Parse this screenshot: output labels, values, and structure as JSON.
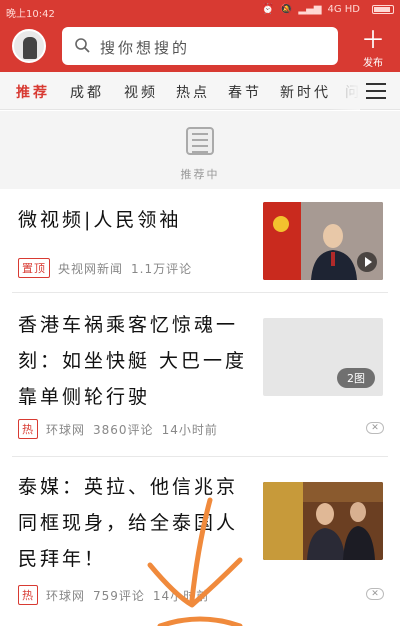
{
  "status_bar": {
    "time": "晚上10:42",
    "network": "4G HD",
    "battery": "84%"
  },
  "search": {
    "placeholder": "搜你想搜的"
  },
  "publish": {
    "label": "发布"
  },
  "tabs": [
    "推荐",
    "成都",
    "视频",
    "热点",
    "春节",
    "新时代",
    "问"
  ],
  "loading": {
    "label": "推荐中"
  },
  "news": [
    {
      "title": "微视频|人民领袖",
      "tag": "置顶",
      "source": "央视网新闻",
      "comments": "1.1万评论",
      "time": ""
    },
    {
      "title": "香港车祸乘客忆惊魂一刻：如坐快艇 大巴一度靠单侧轮行驶",
      "tag": "热",
      "source": "环球网",
      "comments": "3860评论",
      "time": "14小时前",
      "photo_count": "2图"
    },
    {
      "title": "泰媒：英拉、他信兆京同框现身，给全泰国人民拜年！",
      "tag": "热",
      "source": "环球网",
      "comments": "759评论",
      "time": "14小时前"
    }
  ],
  "colors": {
    "brand": "#d83a32",
    "annotation": "#f08a3c"
  }
}
